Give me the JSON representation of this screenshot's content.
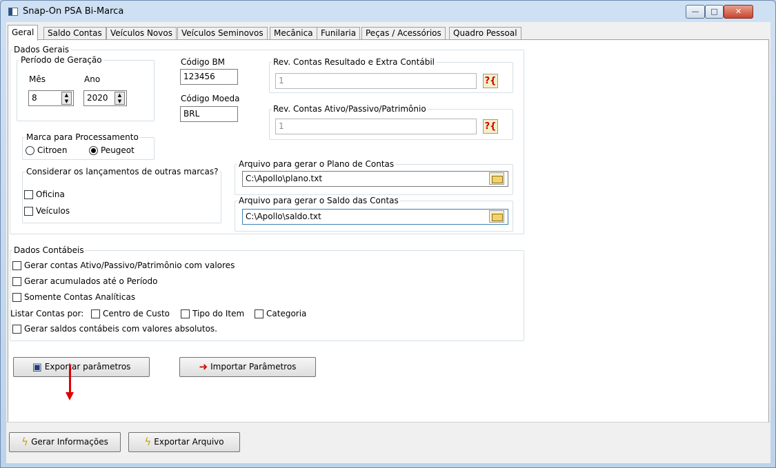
{
  "window": {
    "title": "Snap-On PSA Bi-Marca",
    "controls": [
      "—",
      "□",
      "✕"
    ]
  },
  "tabs": [
    {
      "label": "Geral",
      "active": true
    },
    {
      "label": "Saldo Contas"
    },
    {
      "label": "Veículos Novos"
    },
    {
      "label": "Veículos Seminovos"
    },
    {
      "label": "Mecânica"
    },
    {
      "label": "Funilaria"
    },
    {
      "label": "Peças / Acessórios"
    },
    {
      "label": "Quadro Pessoal"
    }
  ],
  "dados_gerais": {
    "legend": "Dados Gerais",
    "periodo": {
      "legend": "Período de Geração",
      "mes_label": "Mês",
      "mes_value": "8",
      "ano_label": "Ano",
      "ano_value": "2020"
    },
    "codigo_bm": {
      "label": "Código BM",
      "value": "123456"
    },
    "codigo_moeda": {
      "label": "Código Moeda",
      "value": "BRL"
    },
    "rev_resultado": {
      "legend": "Rev. Contas Resultado e Extra Contábil",
      "value": "1",
      "help": "?{"
    },
    "rev_ativo": {
      "legend": "Rev. Contas Ativo/Passivo/Patrimônio",
      "value": "1",
      "help": "?{"
    },
    "marca": {
      "legend": "Marca para Processamento",
      "options": [
        {
          "label": "Citroen",
          "checked": false
        },
        {
          "label": "Peugeot",
          "checked": true
        }
      ]
    },
    "outras_marcas": {
      "legend": "Considerar os lançamentos de outras marcas?",
      "options": [
        {
          "label": "Oficina",
          "checked": false
        },
        {
          "label": "Veículos",
          "checked": false
        }
      ]
    },
    "arquivo_plano": {
      "legend": "Arquivo para gerar o Plano de Contas",
      "value": "C:\\Apollo\\plano.txt"
    },
    "arquivo_saldo": {
      "legend": "Arquivo para gerar o Saldo das Contas",
      "value": "C:\\Apollo\\saldo.txt"
    }
  },
  "dados_contabeis": {
    "legend": "Dados Contábeis",
    "checks": [
      "Gerar contas Ativo/Passivo/Patrimônio com valores",
      "Gerar acumulados até o Período",
      "Somente Contas Analíticas"
    ],
    "listar_label": "Listar Contas por:",
    "listar_options": [
      "Centro de Custo",
      "Tipo do Item",
      "Categoria"
    ],
    "absolutos": "Gerar saldos contábeis com valores absolutos."
  },
  "buttons": {
    "exportar_parametros": "Exportar parâmetros",
    "importar_parametros": "Importar Parâmetros",
    "gerar_informacoes": "Gerar Informações",
    "exportar_arquivo": "Exportar Arquivo"
  },
  "colors": {
    "annotation_arrow": "#e00000",
    "tab_active_bg": "#ffffff",
    "window_frame": "#bcd3eb"
  }
}
